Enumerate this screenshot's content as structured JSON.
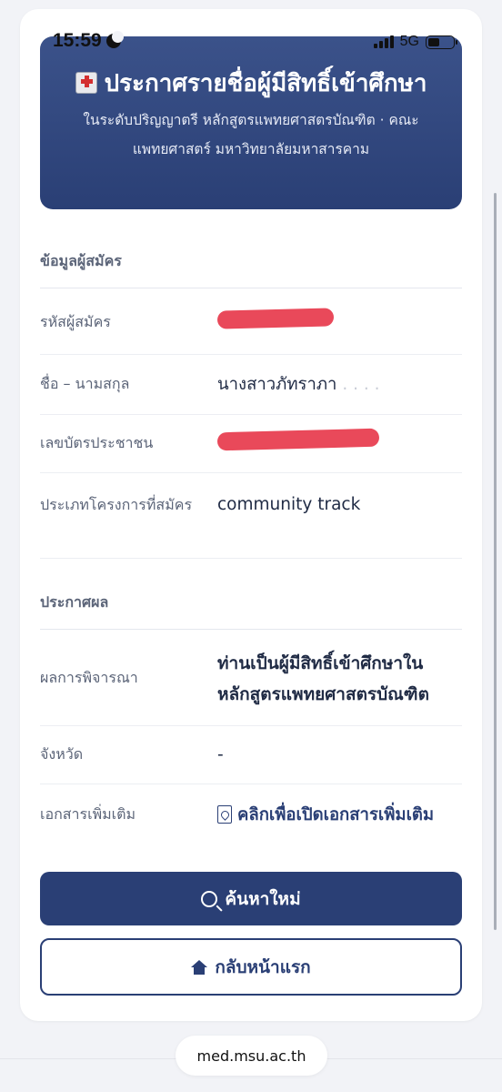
{
  "status_bar": {
    "time": "15:59",
    "network": "5G"
  },
  "header": {
    "title": "ประกาศรายชื่อผู้มีสิทธิ์เข้าศึกษา",
    "subtitle": "ในระดับปริญญาตรี หลักสูตรแพทยศาสตรบัณฑิต · คณะแพทยศาสตร์ มหาวิทยาลัยมหาสารคาม",
    "icon": "hospital-icon"
  },
  "applicant_section": {
    "title": "ข้อมูลผู้สมัคร",
    "rows": [
      {
        "label": "รหัสผู้สมัคร",
        "value": ""
      },
      {
        "label": "ชื่อ – นามสกุล",
        "value": "นางสาวภัทราภา",
        "value_faded": ". . . ."
      },
      {
        "label": "เลขบัตรประชาชน",
        "value": ""
      },
      {
        "label": "ประเภทโครงการที่สมัคร",
        "value": "community track"
      }
    ]
  },
  "result_section": {
    "title": "ประกาศผล",
    "rows": [
      {
        "label": "ผลการพิจารณา",
        "value": "ท่านเป็นผู้มีสิทธิ์เข้าศึกษาในหลักสูตรแพทยศาสตรบัณฑิต"
      },
      {
        "label": "จังหวัด",
        "value": "-"
      },
      {
        "label": "เอกสารเพิ่มเติม",
        "value": "คลิกเพื่อเปิดเอกสารเพิ่มเติม"
      }
    ]
  },
  "buttons": {
    "search_new": "ค้นหาใหม่",
    "back_home": "กลับหน้าแรก"
  },
  "browser": {
    "url": "med.msu.ac.th"
  },
  "colors": {
    "primary": "#2a3f75",
    "header_top": "#3b528a",
    "redaction": "#e9495a"
  }
}
